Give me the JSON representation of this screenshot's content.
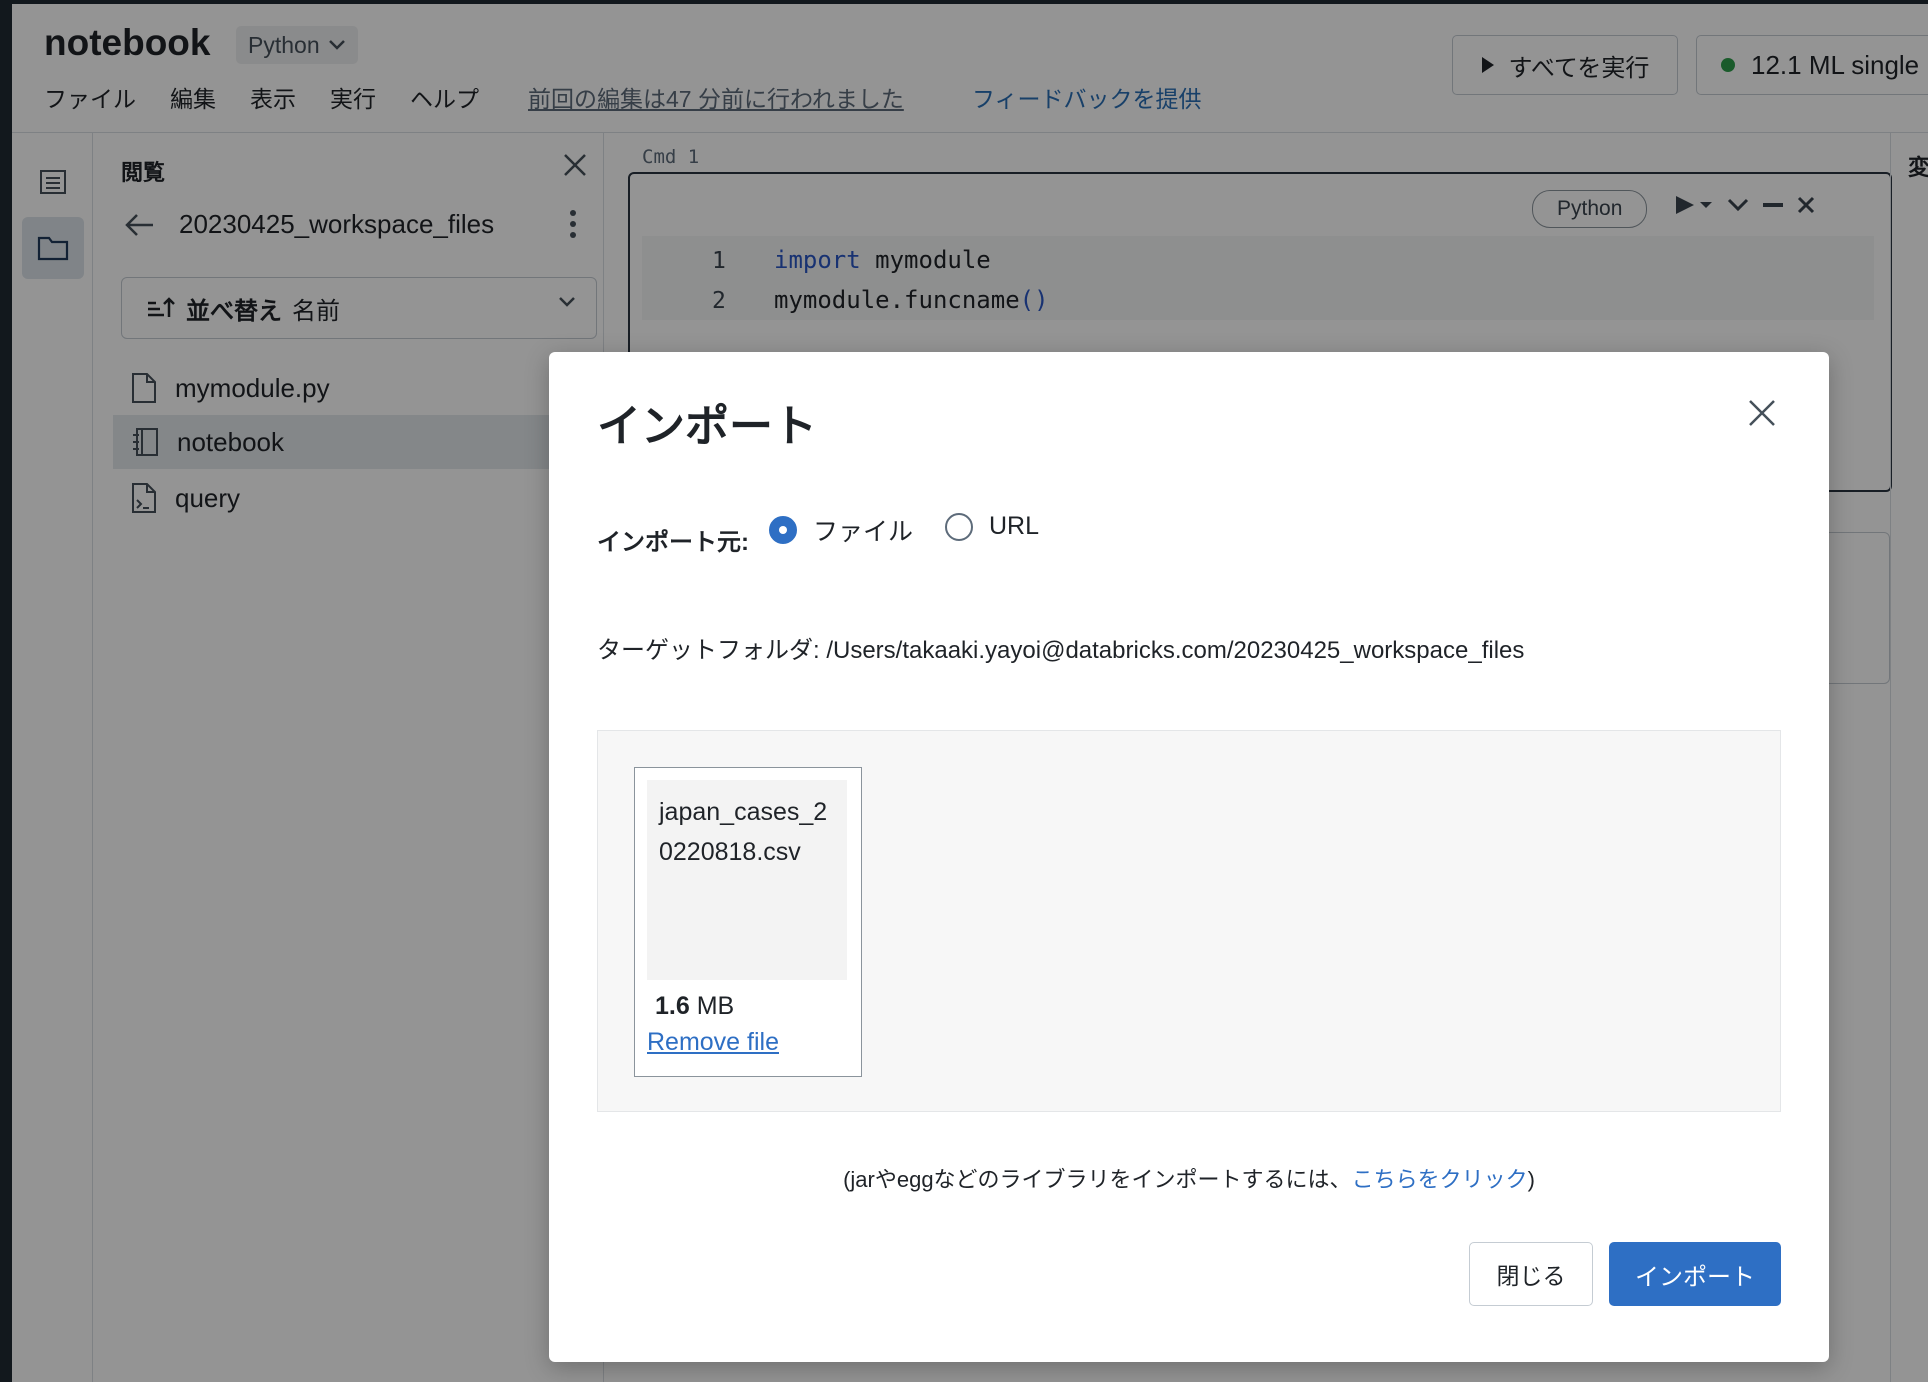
{
  "header": {
    "notebook_title": "notebook",
    "language": "Python",
    "menu": [
      "ファイル",
      "編集",
      "表示",
      "実行",
      "ヘルプ"
    ],
    "last_edit": "前回の編集は47 分前に行われました",
    "feedback": "フィードバックを提供",
    "run_all": "すべてを実行",
    "cluster": "12.1 ML single"
  },
  "browser": {
    "title": "閲覧",
    "path": "20230425_workspace_files",
    "sort_label": "並べ替え",
    "sort_value": "名前",
    "files": [
      {
        "name": "mymodule.py",
        "icon": "file-icon"
      },
      {
        "name": "notebook",
        "icon": "notebook-icon"
      },
      {
        "name": "query",
        "icon": "query-icon"
      }
    ]
  },
  "cell": {
    "cmd_label": "Cmd  1",
    "language": "Python",
    "lines": [
      {
        "num": "1",
        "keyword": "import",
        "rest": " mymodule"
      },
      {
        "num": "2",
        "text": "mymodule.funcname",
        "paren": "()"
      }
    ]
  },
  "right_panel": {
    "label": "変"
  },
  "modal": {
    "title": "インポート",
    "source_label": "インポート元:",
    "option_file": "ファイル",
    "option_url": "URL",
    "selected": "ファイル",
    "target_folder": "ターゲットフォルダ: /Users/takaaki.yayoi@databricks.com/20230425_workspace_files",
    "file": {
      "name": "japan_cases_20220818.csv",
      "size_value": "1.6",
      "size_unit": "MB",
      "remove": "Remove file"
    },
    "lib_note_prefix": "(jarやeggなどのライブラリをインポートするには、",
    "lib_note_link": "こちらをクリック",
    "lib_note_suffix": ")",
    "close_button": "閉じる",
    "import_button": "インポート"
  }
}
